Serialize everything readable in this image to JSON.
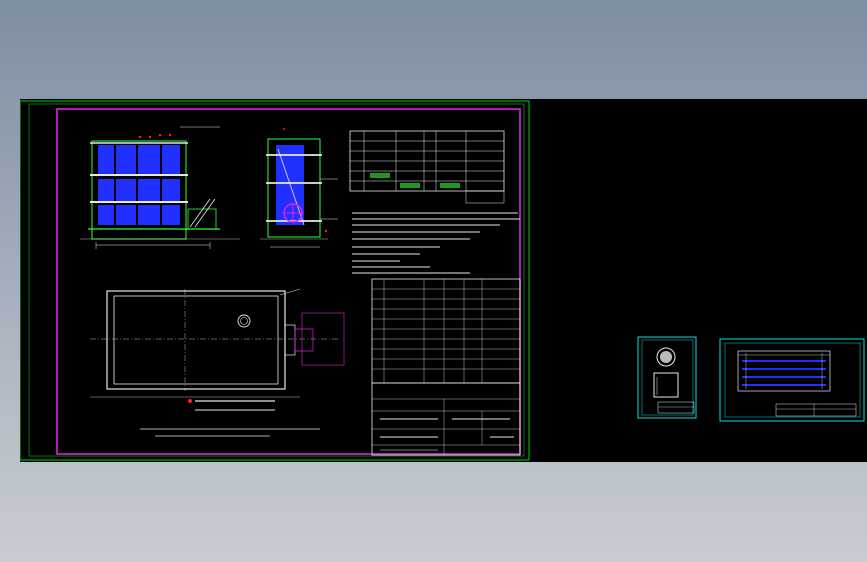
{
  "colors": {
    "background_top": "#7d8da3",
    "background_bottom": "#c9cdd2",
    "canvas": "#000000",
    "sheet_border": "#00d000",
    "frame_magenta": "#e020e0",
    "drawing_blue": "#2030ff",
    "drawing_green": "#30ff30",
    "drawing_cyan": "#00e0e0",
    "drawing_white": "#e8e8e8",
    "marker_red": "#ff2020"
  },
  "sheets": [
    {
      "name": "main-drawing-sheet",
      "views": [
        "front-elevation",
        "side-elevation",
        "plan-view",
        "technical-table",
        "notes",
        "bill-of-materials",
        "title-block"
      ]
    },
    {
      "name": "detail-sheet-small",
      "views": [
        "circular-detail",
        "box-detail",
        "title-block"
      ]
    },
    {
      "name": "detail-sheet-layout",
      "views": [
        "tank-layout-plan",
        "title-block"
      ]
    }
  ]
}
